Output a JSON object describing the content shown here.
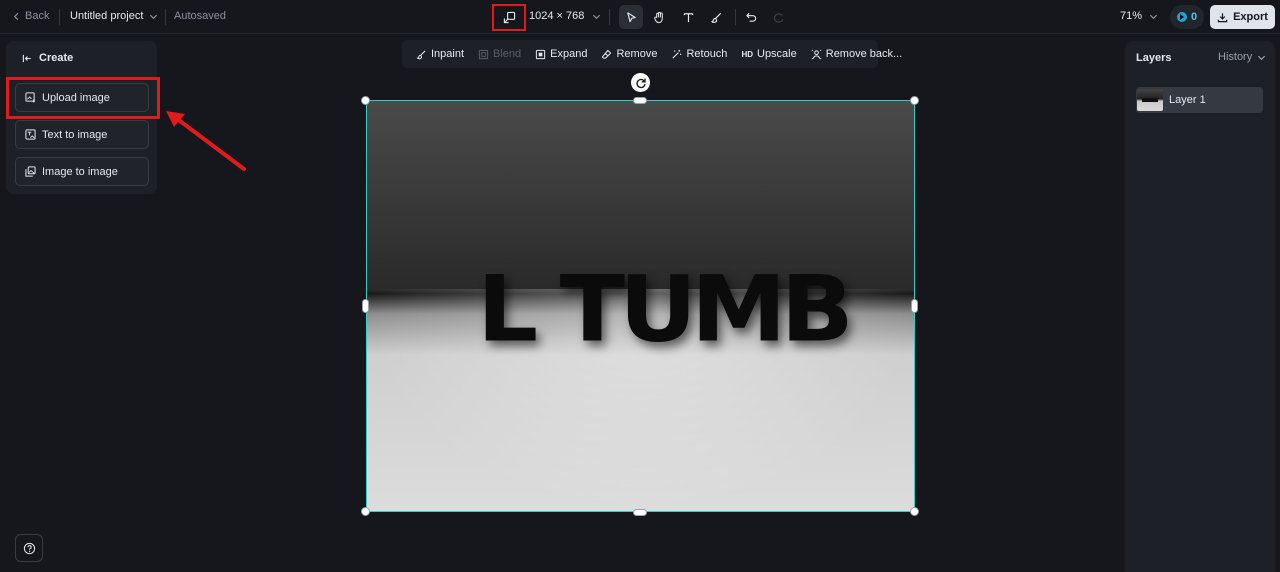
{
  "topbar": {
    "back_label": "Back",
    "project_name": "Untitled project",
    "save_status": "Autosaved",
    "canvas_size": "1024 × 768",
    "zoom": "71%",
    "credits": "0",
    "export_label": "Export"
  },
  "tools": [
    {
      "name": "select",
      "icon": "cursor-icon"
    },
    {
      "name": "hand",
      "icon": "hand-icon"
    },
    {
      "name": "text",
      "icon": "text-icon"
    },
    {
      "name": "brush",
      "icon": "brush-icon"
    },
    {
      "name": "undo",
      "icon": "undo-icon"
    },
    {
      "name": "redo",
      "icon": "redo-icon"
    }
  ],
  "create_panel": {
    "title": "Create",
    "items": [
      {
        "label": "Upload image",
        "icon": "upload-image-icon"
      },
      {
        "label": "Text to image",
        "icon": "text-to-image-icon"
      },
      {
        "label": "Image to image",
        "icon": "image-to-image-icon"
      }
    ]
  },
  "edit_toolbar": {
    "inpaint": "Inpaint",
    "blend": "Blend",
    "expand": "Expand",
    "remove": "Remove",
    "retouch": "Retouch",
    "hd_badge": "HD",
    "upscale": "Upscale",
    "remove_background": "Remove back..."
  },
  "canvas": {
    "image_text": "L TUMB"
  },
  "layers_panel": {
    "title": "Layers",
    "history_label": "History",
    "layers": [
      {
        "label": "Layer 1"
      }
    ]
  },
  "colors": {
    "accent_teal": "#2fd0c6",
    "highlight_red": "#e11b1b",
    "background": "#15171c",
    "panel": "#1d2026"
  }
}
